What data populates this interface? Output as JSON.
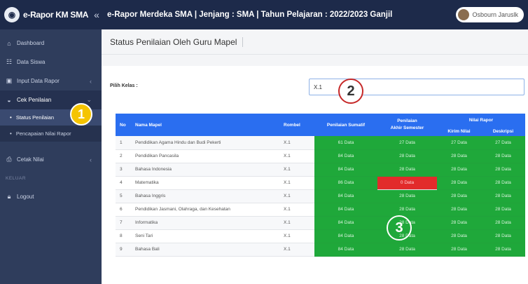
{
  "topbar": {
    "brand": "e-Rapor KM SMA",
    "collapse_icon": "«",
    "title": "e-Rapor Merdeka SMA | Jenjang : SMA | Tahun Pelajaran : 2022/2023 Ganjil",
    "user_name": "Osbourn Jaruslk"
  },
  "sidebar": {
    "items": [
      {
        "label": "Dashboard",
        "icon": "home-icon"
      },
      {
        "label": "Data Siswa",
        "icon": "users-icon"
      },
      {
        "label": "Input Data Rapor",
        "icon": "form-icon"
      },
      {
        "label": "Cek Penilaian",
        "icon": "car-icon"
      }
    ],
    "subitems": [
      {
        "label": "Status Penilaian"
      },
      {
        "label": "Pencapaian Nilai Rapor"
      }
    ],
    "cetak": {
      "label": "Cetak Nilai",
      "icon": "print-icon"
    },
    "section": "KELUAR",
    "logout": {
      "label": "Logout",
      "icon": "lock-icon"
    }
  },
  "main": {
    "page_title": "Status Penilaian Oleh Guru Mapel",
    "pilih_kelas_label": "Pilih Kelas :",
    "kelas_value": "X.1"
  },
  "table": {
    "headers": {
      "no": "No",
      "mapel": "Nama Mapel",
      "rombel": "Rombel",
      "sumatif": "Penilaian Sumatif",
      "akhir_line1": "Penilaian",
      "akhir_line2": "Akhir Semester",
      "nilai_rapor": "Nilai Rapor",
      "kirim": "Kirim Nilai",
      "deskripsi": "Deskripsi"
    },
    "rows": [
      {
        "no": "1",
        "mapel": "Pendidikan Agama Hindu dan Budi Pekerti",
        "rombel": "X.1",
        "sumatif": "61 Data",
        "akhir": "27 Data",
        "kirim": "27 Data",
        "deskripsi": "27 Data"
      },
      {
        "no": "2",
        "mapel": "Pendidikan Pancasila",
        "rombel": "X.1",
        "sumatif": "84 Data",
        "akhir": "28 Data",
        "kirim": "28 Data",
        "deskripsi": "28 Data"
      },
      {
        "no": "3",
        "mapel": "Bahasa Indonesia",
        "rombel": "X.1",
        "sumatif": "84 Data",
        "akhir": "28 Data",
        "kirim": "28 Data",
        "deskripsi": "28 Data"
      },
      {
        "no": "4",
        "mapel": "Matematika",
        "rombel": "X.1",
        "sumatif": "86 Data",
        "akhir": "0 Data",
        "kirim": "28 Data",
        "deskripsi": "28 Data"
      },
      {
        "no": "5",
        "mapel": "Bahasa Inggris",
        "rombel": "X.1",
        "sumatif": "84 Data",
        "akhir": "28 Data",
        "kirim": "28 Data",
        "deskripsi": "28 Data"
      },
      {
        "no": "6",
        "mapel": "Pendidikan Jasmani, Olahraga, dan Kesehatan",
        "rombel": "X.1",
        "sumatif": "84 Data",
        "akhir": "28 Data",
        "kirim": "28 Data",
        "deskripsi": "28 Data"
      },
      {
        "no": "7",
        "mapel": "Informatika",
        "rombel": "X.1",
        "sumatif": "84 Data",
        "akhir": "28 Data",
        "kirim": "28 Data",
        "deskripsi": "28 Data"
      },
      {
        "no": "8",
        "mapel": "Seni Tari",
        "rombel": "X.1",
        "sumatif": "84 Data",
        "akhir": "28 Data",
        "kirim": "28 Data",
        "deskripsi": "28 Data"
      },
      {
        "no": "9",
        "mapel": "Bahasa Bali",
        "rombel": "X.1",
        "sumatif": "84 Data",
        "akhir": "28 Data",
        "kirim": "28 Data",
        "deskripsi": "28 Data"
      }
    ]
  },
  "annotations": {
    "m1": "1",
    "m2": "2",
    "m3": "3"
  },
  "colors": {
    "complete": "#1fa83a",
    "missing": "#e22b2b",
    "header": "#2a6ef0",
    "sidebar": "#2f3d5c"
  }
}
